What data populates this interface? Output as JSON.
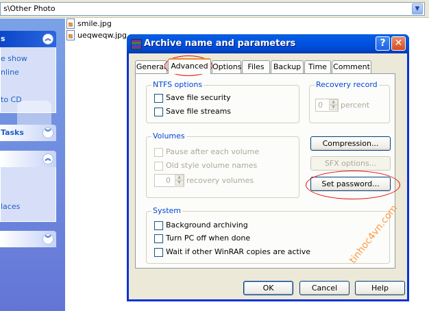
{
  "explorer": {
    "address_text": "s\\Other Photo",
    "taskpane": {
      "section1_title": "s",
      "section1_links": [
        "e show",
        "nline",
        "to CD"
      ],
      "section2_title": "Tasks",
      "section3_title": "",
      "section3_links": [
        "laces"
      ]
    },
    "files": [
      {
        "name": "smile.jpg"
      },
      {
        "name": "ueqweqw.jpg"
      }
    ]
  },
  "dialog": {
    "title": "Archive name and parameters",
    "help_button": "?",
    "close_button": "✕",
    "tabs": [
      {
        "label": "General",
        "active": false
      },
      {
        "label": "Advanced",
        "active": true
      },
      {
        "label": "Options",
        "active": false
      },
      {
        "label": "Files",
        "active": false
      },
      {
        "label": "Backup",
        "active": false
      },
      {
        "label": "Time",
        "active": false
      },
      {
        "label": "Comment",
        "active": false
      }
    ],
    "ntfs": {
      "title": "NTFS options",
      "save_security": "Save file security",
      "save_streams": "Save file streams"
    },
    "recovery": {
      "title": "Recovery record",
      "value": "0",
      "unit": "percent"
    },
    "volumes": {
      "title": "Volumes",
      "pause": "Pause after each volume",
      "old_style": "Old style volume names",
      "value": "0",
      "unit": "recovery volumes"
    },
    "buttons": {
      "compression": "Compression...",
      "sfx": "SFX options...",
      "set_password": "Set password..."
    },
    "system": {
      "title": "System",
      "background": "Background archiving",
      "turn_off": "Turn PC off when done",
      "wait": "Wait if other WinRAR copies are active"
    },
    "footer": {
      "ok": "OK",
      "cancel": "Cancel",
      "help": "Help"
    }
  },
  "watermark": "tinhoc4vn.com",
  "colors": {
    "titlebar": "#0054e3",
    "taskpane": "#6375d6",
    "annotation": "#e01010",
    "watermark": "#ff8a1f"
  }
}
